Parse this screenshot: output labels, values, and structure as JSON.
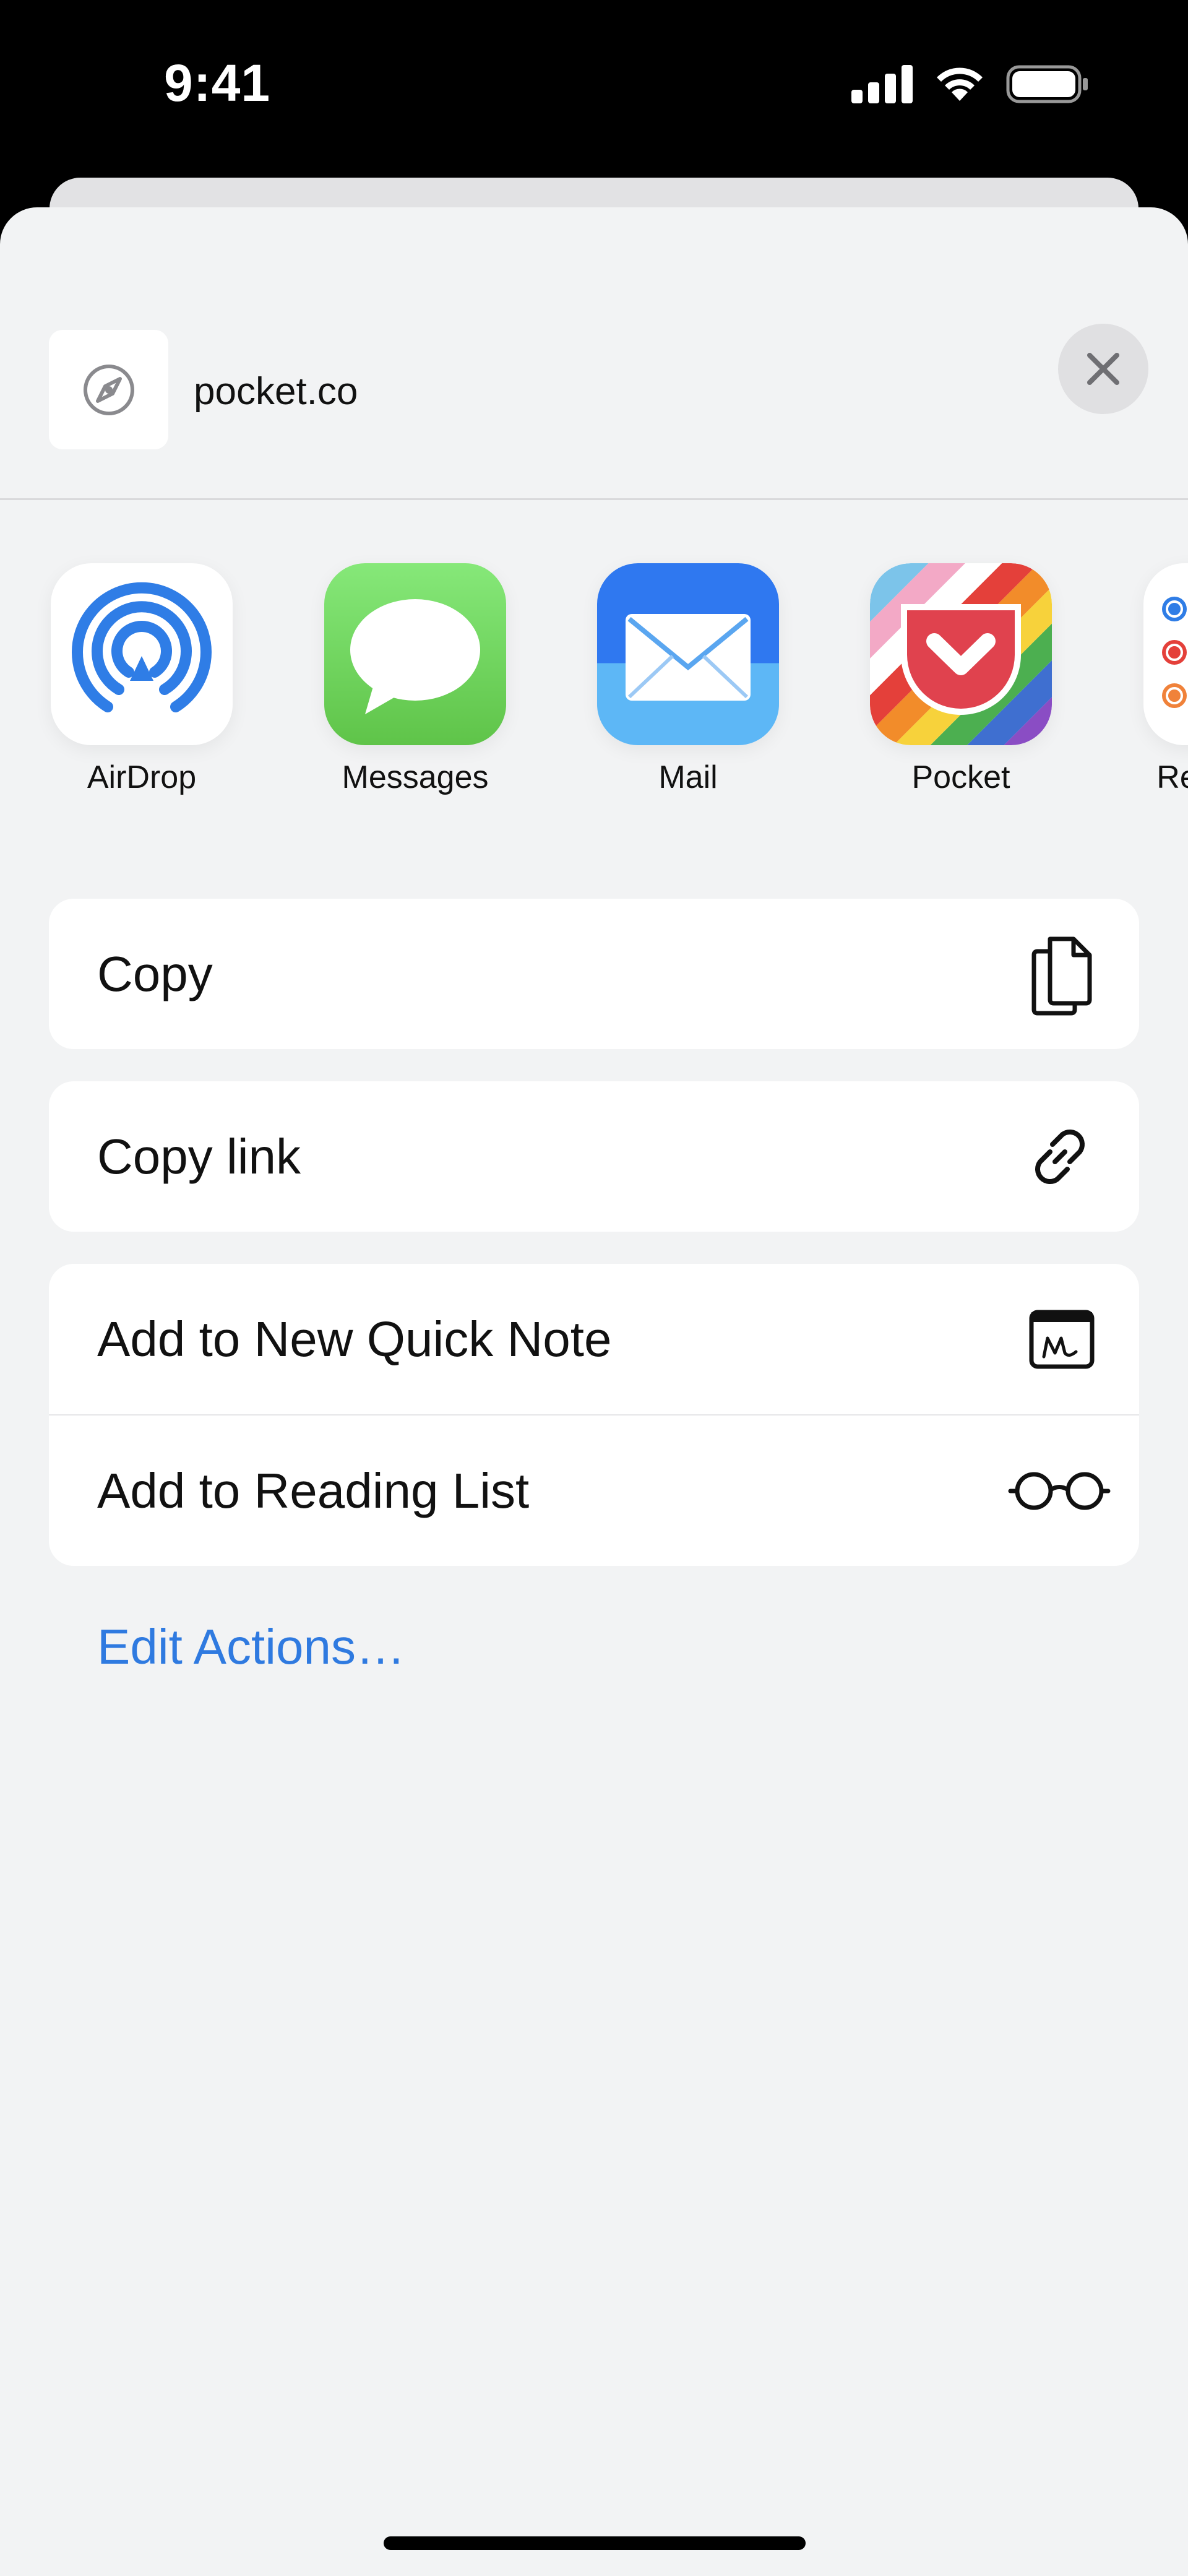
{
  "status_bar": {
    "time": "9:41"
  },
  "header": {
    "title": "pocket.co",
    "thumbnail_icon": "compass-icon",
    "close_icon": "close-icon"
  },
  "share_targets": [
    {
      "label": "AirDrop",
      "icon": "airdrop-icon"
    },
    {
      "label": "Messages",
      "icon": "messages-icon"
    },
    {
      "label": "Mail",
      "icon": "mail-icon"
    },
    {
      "label": "Pocket",
      "icon": "pocket-icon"
    },
    {
      "label": "Reminders",
      "icon": "reminders-icon"
    }
  ],
  "actions": {
    "copy": {
      "label": "Copy",
      "icon": "copy-icon"
    },
    "copy_link": {
      "label": "Copy link",
      "icon": "link-icon"
    },
    "quick_note": {
      "label": "Add to New Quick Note",
      "icon": "quick-note-icon"
    },
    "reading_list": {
      "label": "Add to Reading List",
      "icon": "glasses-icon"
    }
  },
  "edit_actions_label": "Edit Actions…",
  "colors": {
    "accent": "#2f7ae0",
    "sheet_background": "#f2f3f4",
    "close_button_background": "#e0e0e2"
  }
}
